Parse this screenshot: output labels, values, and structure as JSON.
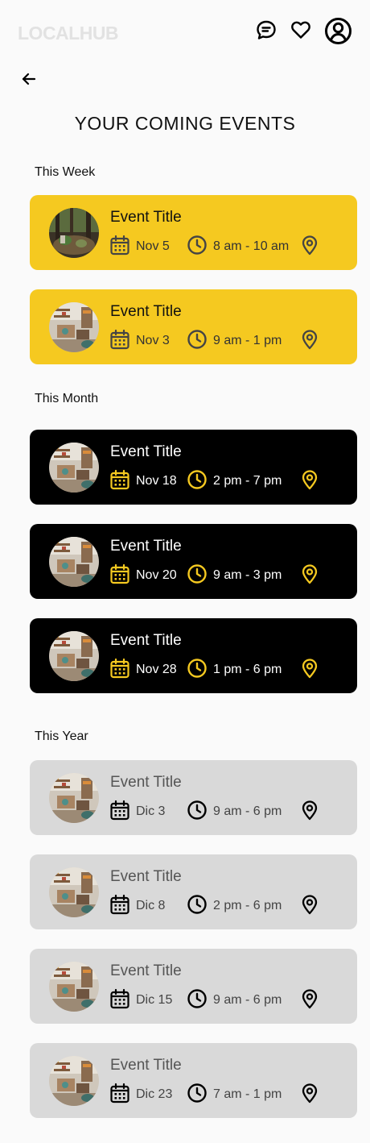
{
  "app": {
    "logo": "LOCALHUB"
  },
  "page": {
    "title": "YOUR COMING EVENTS"
  },
  "icons": {
    "header": [
      "chat-icon",
      "heart-icon",
      "user-icon"
    ],
    "back": "arrow-left-icon",
    "card": [
      "calendar-icon",
      "clock-icon",
      "location-pin-icon"
    ]
  },
  "colors": {
    "accent": "#f5c920",
    "dark": "#000000",
    "muted": "#d9d9d9",
    "background": "#fafafa"
  },
  "sections": [
    {
      "title": "This Week",
      "events": [
        {
          "title": "Event Title",
          "date": "Nov 5",
          "time": "8 am - 10 am"
        },
        {
          "title": "Event Title",
          "date": "Nov 3",
          "time": "9 am - 1 pm"
        }
      ]
    },
    {
      "title": "This Month",
      "events": [
        {
          "title": "Event Title",
          "date": "Nov 18",
          "time": "2 pm - 7 pm"
        },
        {
          "title": "Event Title",
          "date": "Nov 20",
          "time": "9 am - 3 pm"
        },
        {
          "title": "Event Title",
          "date": "Nov 28",
          "time": "1 pm - 6 pm"
        }
      ]
    },
    {
      "title": "This Year",
      "events": [
        {
          "title": "Event Title",
          "date": "Dic 3",
          "time": "9 am - 6 pm"
        },
        {
          "title": "Event Title",
          "date": "Dic 8",
          "time": "2 pm - 6 pm"
        },
        {
          "title": "Event Title",
          "date": "Dic 15",
          "time": "9 am - 6 pm"
        },
        {
          "title": "Event Title",
          "date": "Dic 23",
          "time": "7 am - 1 pm"
        }
      ]
    }
  ]
}
